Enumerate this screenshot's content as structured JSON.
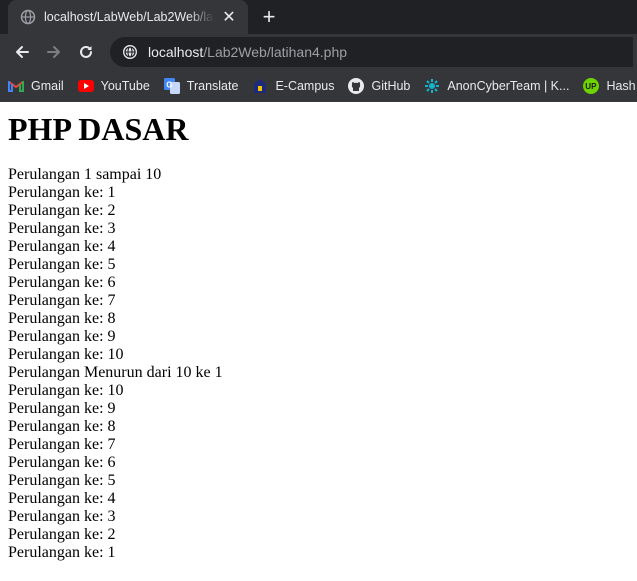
{
  "browser": {
    "tab": {
      "title": "localhost/LabWeb/Lab2Web/latihan4.php",
      "close_symbol": "✕",
      "favicon": "globe-icon"
    },
    "new_tab_symbol": "+",
    "address": {
      "host": "localhost",
      "path": "/Lab2Web/latihan4.php",
      "info_icon": "site-info-icon"
    },
    "bookmarks": [
      {
        "label": "Gmail",
        "icon": "gmail-icon"
      },
      {
        "label": "YouTube",
        "icon": "youtube-icon"
      },
      {
        "label": "Translate",
        "icon": "translate-icon"
      },
      {
        "label": "E-Campus",
        "icon": "ecampus-icon"
      },
      {
        "label": "GitHub",
        "icon": "github-icon"
      },
      {
        "label": "AnonCyberTeam | K...",
        "icon": "anoncyberteam-icon"
      },
      {
        "label": "Hash",
        "icon": "hash-icon"
      }
    ]
  },
  "page": {
    "heading": "PHP DASAR",
    "lines": [
      "Perulangan 1 sampai 10",
      "Perulangan ke: 1",
      "Perulangan ke: 2",
      "Perulangan ke: 3",
      "Perulangan ke: 4",
      "Perulangan ke: 5",
      "Perulangan ke: 6",
      "Perulangan ke: 7",
      "Perulangan ke: 8",
      "Perulangan ke: 9",
      "Perulangan ke: 10",
      "Perulangan Menurun dari 10 ke 1",
      "Perulangan ke: 10",
      "Perulangan ke: 9",
      "Perulangan ke: 8",
      "Perulangan ke: 7",
      "Perulangan ke: 6",
      "Perulangan ke: 5",
      "Perulangan ke: 4",
      "Perulangan ke: 3",
      "Perulangan ke: 2",
      "Perulangan ke: 1"
    ]
  }
}
